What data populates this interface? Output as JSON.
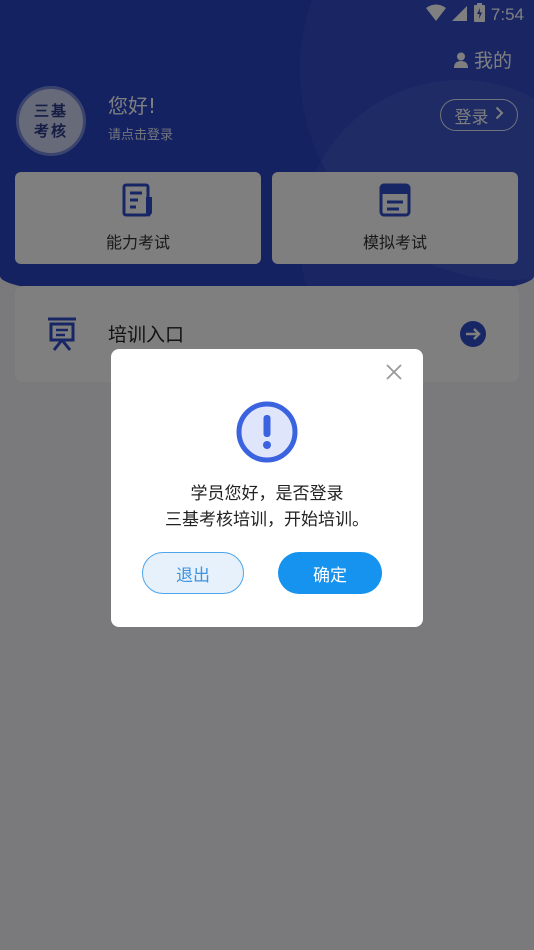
{
  "status_bar": {
    "time": "7:54",
    "icons": [
      "wifi-icon",
      "signal-icon",
      "battery-icon"
    ]
  },
  "header": {
    "mine_label": "我的",
    "logo_text": [
      "三基",
      "考核"
    ],
    "greeting": "您好!",
    "sub_greeting": "请点击登录",
    "login_label": "登录"
  },
  "cards": [
    {
      "label": "能力考试",
      "icon": "ability-exam-icon"
    },
    {
      "label": "模拟考试",
      "icon": "mock-exam-icon"
    }
  ],
  "training_entry": {
    "label": "培训入口",
    "icon": "training-icon"
  },
  "dialog": {
    "line1": "学员您好，是否登录",
    "line2": "三基考核培训，开始培训。",
    "cancel_label": "退出",
    "confirm_label": "确定"
  },
  "colors": {
    "header_blue": "#2944c4",
    "confirm_blue": "#1693ee",
    "alert_blue": "#3b63e0"
  }
}
